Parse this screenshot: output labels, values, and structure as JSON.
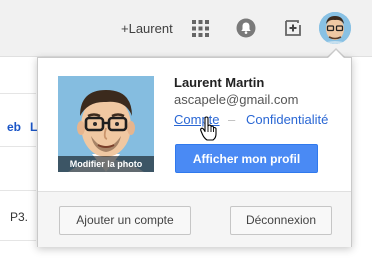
{
  "topbar": {
    "user_label": "+Laurent",
    "icons": [
      "apps-grid-icon",
      "notifications-bell-icon",
      "share-plus-icon",
      "user-avatar"
    ]
  },
  "background": {
    "tab1": "eb",
    "tab2": "L",
    "text": "P3."
  },
  "account_popup": {
    "photo_caption": "Modifier la photo",
    "name": "Laurent Martin",
    "email": "ascapele@gmail.com",
    "link_account": "Compte",
    "link_separator": "–",
    "link_privacy": "Confidentialité",
    "profile_button": "Afficher mon profil",
    "add_account_button": "Ajouter un compte",
    "logout_button": "Déconnexion"
  },
  "colors": {
    "primary_button": "#4a8af4",
    "link": "#2a67d4",
    "topbar_bg": "#f1f1f1"
  }
}
